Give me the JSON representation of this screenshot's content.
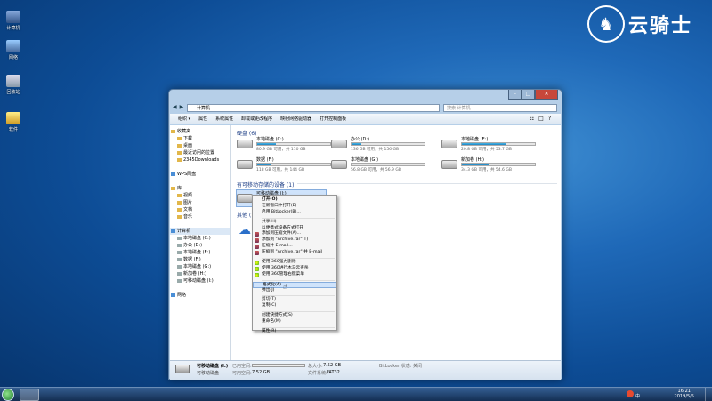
{
  "desktop": {
    "icons": [
      {
        "label": "计算机"
      },
      {
        "label": "网络"
      },
      {
        "label": "回收站"
      },
      {
        "label": "软件"
      }
    ],
    "brand": "云骑士"
  },
  "window": {
    "address": "计算机",
    "search_placeholder": "搜索 计算机",
    "toolbar": [
      "组织 ▾",
      "属性",
      "系统属性",
      "卸载或更改程序",
      "映射网络驱动器",
      "打开控制面板"
    ],
    "sidebar": [
      {
        "label": "收藏夹",
        "icon": "star-icon"
      },
      {
        "label": "下载",
        "icon": "folder-icon"
      },
      {
        "label": "桌面",
        "icon": "folder-icon"
      },
      {
        "label": "最近访问的位置",
        "icon": "folder-icon"
      },
      {
        "label": "2345Downloads",
        "icon": "folder-icon"
      },
      {
        "label": "",
        "icon": ""
      },
      {
        "label": "WPS网盘",
        "icon": "cloud-icon"
      },
      {
        "label": "",
        "icon": ""
      },
      {
        "label": "库",
        "icon": "library-icon"
      },
      {
        "label": "视频",
        "icon": "folder-icon"
      },
      {
        "label": "图片",
        "icon": "folder-icon"
      },
      {
        "label": "文档",
        "icon": "folder-icon"
      },
      {
        "label": "音乐",
        "icon": "folder-icon"
      },
      {
        "label": "",
        "icon": ""
      },
      {
        "label": "计算机",
        "icon": "computer-icon"
      },
      {
        "label": "本地磁盘 (C:)",
        "icon": "drive-icon"
      },
      {
        "label": "办公 (D:)",
        "icon": "drive-icon"
      },
      {
        "label": "本地磁盘 (E:)",
        "icon": "drive-icon"
      },
      {
        "label": "数据 (F:)",
        "icon": "drive-icon"
      },
      {
        "label": "本地磁盘 (G:)",
        "icon": "drive-icon"
      },
      {
        "label": "新加卷 (H:)",
        "icon": "drive-icon"
      },
      {
        "label": "可移动磁盘 (I:)",
        "icon": "usb-icon"
      },
      {
        "label": "",
        "icon": ""
      },
      {
        "label": "网络",
        "icon": "network-icon"
      }
    ],
    "hard_disks_title": "硬盘 (6)",
    "drives": [
      {
        "name": "本地磁盘 (C:)",
        "free": "80.9 GB 可用，共 110 GB",
        "used": 0.26
      },
      {
        "name": "办公 (D:)",
        "free": "136 GB 可用，共 156 GB",
        "used": 0.13
      },
      {
        "name": "本地磁盘 (E:)",
        "free": "20.8 GB 可用，共 53.7 GB",
        "used": 0.61
      },
      {
        "name": "数据 (F:)",
        "free": "118 GB 可用，共 144 GB",
        "used": 0.18
      },
      {
        "name": "本地磁盘 (G:)",
        "free": "56.8 GB 可用，共 56.9 GB",
        "used": 0.0
      },
      {
        "name": "新加卷 (H:)",
        "free": "34.3 GB 可用，共 54.6 GB",
        "used": 0.37
      }
    ],
    "removable_title": "有可移动存储的设备 (1)",
    "removable": {
      "name": "可移动磁盘 (I:)"
    },
    "other_title": "其他 (1)",
    "status": {
      "name": "可移动磁盘 (I:)",
      "type": "可移动磁盘",
      "used_label": "已用空间:",
      "free_label": "可用空间:",
      "free_value": "7.52 GB",
      "total_label": "总大小:",
      "total_value": "7.52 GB",
      "fs_label": "文件系统:",
      "fs_value": "FAT32",
      "bitlocker": "BitLocker 状态: 关闭"
    }
  },
  "context_menu": [
    {
      "label": "打开(O)",
      "bold": true
    },
    {
      "label": "在新窗口中打开(E)"
    },
    {
      "label": "启用 BitLocker(B)..."
    },
    {
      "sep": true
    },
    {
      "label": "共享(H)"
    },
    {
      "label": "以便携式设备方式打开"
    },
    {
      "label": "添加到压缩文件(A)...",
      "icon": "winrar"
    },
    {
      "label": "添加到 \"Archive.rar\"(T)",
      "icon": "winrar"
    },
    {
      "label": "压缩并 E-mail...",
      "icon": "winrar"
    },
    {
      "label": "压缩到 \"Archive.rar\" 并 E-mail",
      "icon": "winrar"
    },
    {
      "sep": true
    },
    {
      "label": "使用 360强力删除",
      "icon": "360"
    },
    {
      "label": "使用 360进行木马云查杀",
      "icon": "360"
    },
    {
      "label": "使用 360管理右键菜单",
      "icon": "360"
    },
    {
      "sep": true
    },
    {
      "label": "格式化(A)...",
      "highlight": true
    },
    {
      "label": "弹出(J)"
    },
    {
      "sep": true
    },
    {
      "label": "剪切(T)"
    },
    {
      "label": "复制(C)"
    },
    {
      "sep": true
    },
    {
      "label": "创建快捷方式(S)"
    },
    {
      "label": "重命名(M)"
    },
    {
      "sep": true
    },
    {
      "label": "属性(R)"
    }
  ],
  "taskbar": {
    "time": "16:21",
    "date": "2019/5/5",
    "tray": "中"
  }
}
